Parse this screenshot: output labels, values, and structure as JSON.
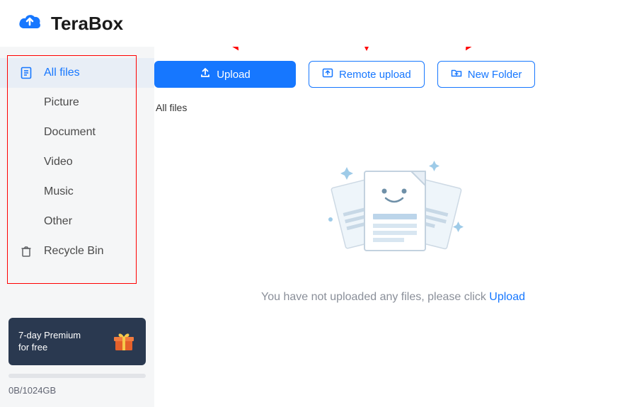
{
  "brand": {
    "name": "TeraBox"
  },
  "sidebar": {
    "items": [
      {
        "label": "All files"
      },
      {
        "label": "Picture"
      },
      {
        "label": "Document"
      },
      {
        "label": "Video"
      },
      {
        "label": "Music"
      },
      {
        "label": "Other"
      },
      {
        "label": "Recycle Bin"
      }
    ]
  },
  "premium": {
    "line1": "7-day Premium",
    "line2": "for free"
  },
  "storage": {
    "text": "0B/1024GB"
  },
  "toolbar": {
    "upload": "Upload",
    "remote_upload": "Remote upload",
    "new_folder": "New Folder"
  },
  "breadcrumb": {
    "path": "All files"
  },
  "empty": {
    "text_left": "You have not uploaded any files, please click ",
    "link": "Upload"
  },
  "colors": {
    "primary": "#1677ff",
    "danger": "#ff0000"
  }
}
